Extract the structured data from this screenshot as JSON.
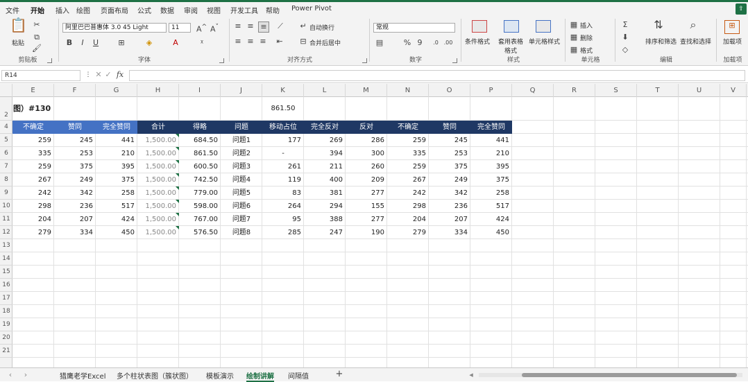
{
  "menu": [
    "文件",
    "开始",
    "插入",
    "绘图",
    "页面布局",
    "公式",
    "数据",
    "审阅",
    "视图",
    "开发工具",
    "帮助",
    "Power Pivot"
  ],
  "ribbon": {
    "clipboard": {
      "paste": "粘贴",
      "group": "剪贴板"
    },
    "font": {
      "name": "阿里巴巴普惠体 3.0 45 Light",
      "size": "11",
      "bold": "B",
      "italic": "I",
      "underline": "U",
      "group": "字体",
      "grow": "A^",
      "shrink": "A˅"
    },
    "alignment": {
      "wrap": "自动换行",
      "merge": "合并后居中",
      "group": "对齐方式"
    },
    "number": {
      "format": "常规",
      "group": "数字",
      "percent": "%",
      "comma": "9"
    },
    "styles": {
      "conditional": "条件格式",
      "table": "套用表格格式",
      "cell": "单元格样式",
      "group": "样式"
    },
    "cells": {
      "insert": "插入",
      "delete": "删除",
      "format": "格式",
      "group": "单元格"
    },
    "editing": {
      "sort": "排序和筛选",
      "find": "查找和选择",
      "group": "编辑"
    },
    "analysis": {
      "label": "加载项",
      "group": "加载项"
    }
  },
  "namebox": "R14",
  "columns": [
    "E",
    "F",
    "G",
    "H",
    "I",
    "J",
    "K",
    "L",
    "M",
    "N",
    "O",
    "P",
    "Q",
    "R",
    "S",
    "T",
    "U",
    "V"
  ],
  "rows": [
    "2",
    "4",
    "5",
    "6",
    "7",
    "8",
    "9",
    "10",
    "11",
    "12",
    "13",
    "14",
    "15",
    "16",
    "17",
    "18",
    "19",
    "20",
    "21"
  ],
  "sheet": {
    "title": "图）#130",
    "k2": "861.50",
    "headers": [
      "不确定",
      "赞同",
      "完全赞同",
      "合计",
      "得略",
      "问题",
      "移动占位",
      "完全反对",
      "反对",
      "不确定",
      "赞同",
      "完全赞同"
    ],
    "data": [
      [
        "259",
        "245",
        "441",
        "1,500.00",
        "684.50",
        "问题1",
        "177",
        "269",
        "286",
        "259",
        "245",
        "441"
      ],
      [
        "335",
        "253",
        "210",
        "1,500.00",
        "861.50",
        "问题2",
        "-",
        "394",
        "300",
        "335",
        "253",
        "210"
      ],
      [
        "259",
        "375",
        "395",
        "1,500.00",
        "600.50",
        "问题3",
        "261",
        "211",
        "260",
        "259",
        "375",
        "395"
      ],
      [
        "267",
        "249",
        "375",
        "1,500.00",
        "742.50",
        "问题4",
        "119",
        "400",
        "209",
        "267",
        "249",
        "375"
      ],
      [
        "242",
        "342",
        "258",
        "1,500.00",
        "779.00",
        "问题5",
        "83",
        "381",
        "277",
        "242",
        "342",
        "258"
      ],
      [
        "298",
        "236",
        "517",
        "1,500.00",
        "598.00",
        "问题6",
        "264",
        "294",
        "155",
        "298",
        "236",
        "517"
      ],
      [
        "204",
        "207",
        "424",
        "1,500.00",
        "767.00",
        "问题7",
        "95",
        "388",
        "277",
        "204",
        "207",
        "424"
      ],
      [
        "279",
        "334",
        "450",
        "1,500.00",
        "576.50",
        "问题8",
        "285",
        "247",
        "190",
        "279",
        "334",
        "450"
      ]
    ]
  },
  "tabs": [
    "猎鹰老学Excel",
    "多个柱状表图（簇状图）",
    "模板演示",
    "绘制讲解",
    "间隔值"
  ],
  "colors": {
    "accent": "#1e7145",
    "header_blue": "#4472c4",
    "header_dark": "#1f3864"
  }
}
